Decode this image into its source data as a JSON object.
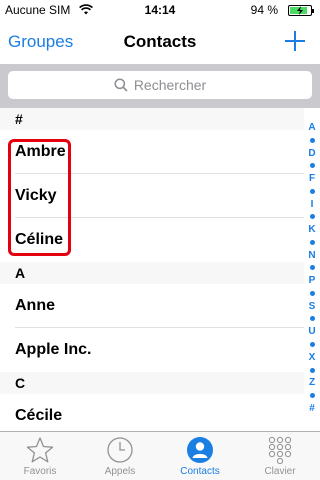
{
  "status_bar": {
    "carrier": "Aucune SIM",
    "time": "14:14",
    "battery": "94 %"
  },
  "nav": {
    "left": "Groupes",
    "title": "Contacts",
    "add_icon": "plus-icon"
  },
  "search": {
    "placeholder": "Rechercher"
  },
  "sections": [
    {
      "header": "#",
      "rows": [
        "Ambre",
        "Vicky",
        "Céline"
      ]
    },
    {
      "header": "A",
      "rows": [
        "Anne",
        "Apple Inc."
      ]
    },
    {
      "header": "C",
      "rows": [
        "Cécile"
      ]
    }
  ],
  "index": [
    "A",
    "D",
    "F",
    "I",
    "K",
    "N",
    "P",
    "S",
    "U",
    "X",
    "Z",
    "#"
  ],
  "tabs": [
    {
      "label": "Favoris",
      "icon": "star-icon",
      "active": false
    },
    {
      "label": "Appels",
      "icon": "clock-icon",
      "active": false
    },
    {
      "label": "Contacts",
      "icon": "person-icon",
      "active": true
    },
    {
      "label": "Clavier",
      "icon": "keypad-icon",
      "active": false
    }
  ],
  "colors": {
    "accent": "#1a7ee3",
    "highlight": "#e4000f"
  }
}
